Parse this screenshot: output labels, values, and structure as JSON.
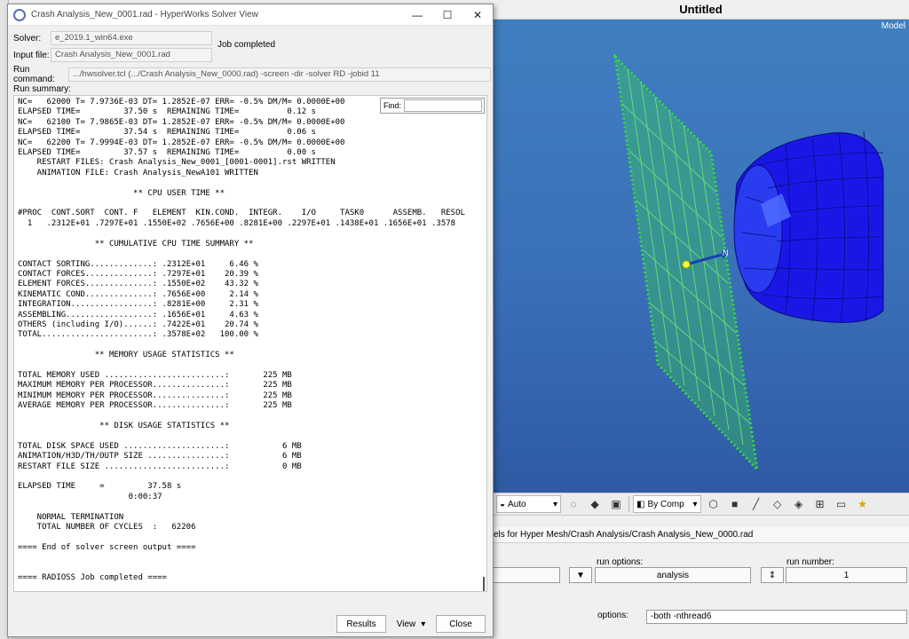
{
  "solver_window": {
    "title": "Crash Analysis_New_0001.rad - HyperWorks Solver View",
    "solver_label": "Solver:",
    "solver_value": "e_2019.1_win64.exe",
    "input_file_label": "Input file:",
    "input_file_value": "Crash Analysis_New_0001.rad",
    "job_status": "Job completed",
    "run_command_label": "Run command:",
    "run_command_value": ".../hwsolver.tcl (.../Crash Analysis_New_0000.rad) -screen -dir -solver RD -jobid 11",
    "run_summary_label": "Run summary:",
    "find_label": "Find:",
    "summary_lines": [
      "NC=   62000 T= 7.9736E-03 DT= 1.2852E-07 ERR= -0.5% DM/M= 0.0000E+00",
      "ELAPSED TIME=         37.50 s  REMAINING TIME=          0.12 s",
      "NC=   62100 T= 7.9865E-03 DT= 1.2852E-07 ERR= -0.5% DM/M= 0.0000E+00",
      "ELAPSED TIME=         37.54 s  REMAINING TIME=          0.06 s",
      "NC=   62200 T= 7.9994E-03 DT= 1.2852E-07 ERR= -0.5% DM/M= 0.0000E+00",
      "ELAPSED TIME=         37.57 s  REMAINING TIME=          0.00 s",
      "    RESTART FILES: Crash Analysis_New_0001_[0001-0001].rst WRITTEN",
      "    ANIMATION FILE: Crash Analysis_NewA101 WRITTEN",
      "",
      "                        ** CPU USER TIME **",
      "",
      "#PROC  CONT.SORT  CONT. F   ELEMENT  KIN.COND.  INTEGR.    I/O     TASK0      ASSEMB.   RESOL",
      "  1   .2312E+01 .7297E+01 .1550E+02 .7656E+00 .8281E+00 .2297E+01 .1438E+01 .1656E+01 .3578",
      "",
      "                ** CUMULATIVE CPU TIME SUMMARY **",
      "",
      "CONTACT SORTING.............: .2312E+01     6.46 %",
      "CONTACT FORCES..............: .7297E+01    20.39 %",
      "ELEMENT FORCES..............: .1550E+02    43.32 %",
      "KINEMATIC COND..............: .7656E+00     2.14 %",
      "INTEGRATION.................: .8281E+00     2.31 %",
      "ASSEMBLING..................: .1656E+01     4.63 %",
      "OTHERS (including I/O)......: .7422E+01    20.74 %",
      "TOTAL.......................: .3578E+02   100.00 %",
      "",
      "                ** MEMORY USAGE STATISTICS **",
      "",
      "TOTAL MEMORY USED .........................:       225 MB",
      "MAXIMUM MEMORY PER PROCESSOR...............:       225 MB",
      "MINIMUM MEMORY PER PROCESSOR...............:       225 MB",
      "AVERAGE MEMORY PER PROCESSOR...............:       225 MB",
      "",
      "                 ** DISK USAGE STATISTICS **",
      "",
      "TOTAL DISK SPACE USED .....................:           6 MB",
      "ANIMATION/H3D/TH/OUTP SIZE ................:           6 MB",
      "RESTART FILE SIZE .........................:           0 MB",
      "",
      "ELAPSED TIME     =         37.58 s",
      "                       0:00:37",
      "",
      "    NORMAL TERMINATION",
      "    TOTAL NUMBER OF CYCLES  :   62206",
      "",
      "==== End of solver screen output ====",
      "",
      "",
      "==== RADIOSS Job completed ===="
    ],
    "buttons": {
      "results": "Results",
      "view": "View",
      "close": "Close"
    }
  },
  "hypermesh": {
    "title": "Untitled",
    "viewport_label": "Model",
    "normal_label": "N",
    "toolbar": {
      "auto_label": "Auto",
      "by_comp_label": "By Comp"
    },
    "path_text": "els for Hyper Mesh/Crash Analysis/Crash Analysis_New_0000.rad",
    "run_options_label": "run options:",
    "run_options_value": "analysis",
    "run_number_label": "run number:",
    "run_number_value": "1",
    "options_label": "options:",
    "options_value": "-both -nthread6"
  },
  "colors": {
    "plane": "#37d847",
    "body": "#1a17e6",
    "viewport_bg": "#3a6fb8"
  }
}
